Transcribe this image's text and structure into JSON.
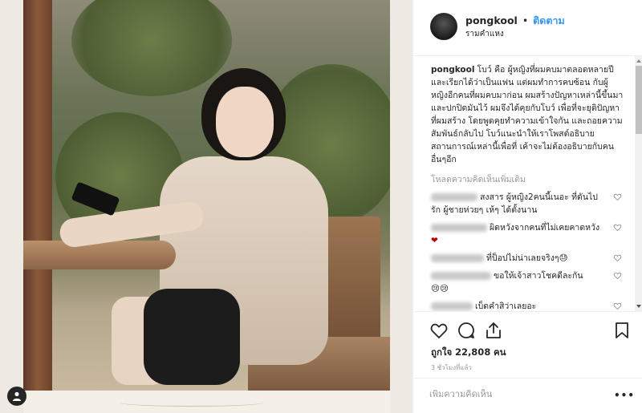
{
  "post": {
    "username": "pongkool",
    "follow_label": "ติดตาม",
    "location": "รามคำแหง",
    "caption_user": "pongkool",
    "caption_text": "โบว์ คือ ผู้หญิงที่ผมคบมาตลอดหลายปี และเรียกได้ว่าเป็นแฟน แต่ผมทำการคบซ้อน กับผู้หญิงอีกคนที่ผมคบมาก่อน ผมสร้างปัญหาเหล่านี้ขึ้นมาและปกปิดมันไว้ ผมจึงได้คุยกับโบว์ เพื่อที่จะยุติปัญหาที่ผมสร้าง โดยพูดคุยทำความเข้าใจกัน และถอยความสัมพันธ์กลับไป โบว์แนะนำให้เราโพสต์อธิบายสถานการณ์เหล่านี้เพื่อที่ เค้าจะไม่ต้องอธิบายกับคนอื่นๆอีก",
    "load_more": "โหลดความคิดเห็นเพิ่มเติม",
    "likes_label": "ถูกใจ",
    "likes_count": "22,808",
    "likes_unit": "คน",
    "time_ago": "3 ชั่วโมงที่แล้ว",
    "comment_placeholder": "เพิ่มความคิดเห็น",
    "more_label": "•••"
  },
  "comments": [
    {
      "text": "สงสาร ผู้หญิง2คนนี้เนอะ ที่ดันไปรัก ผู้ชายห่วยๆ เห้ๆ ได้ตั้งนาน",
      "emoji": ""
    },
    {
      "text": "ผิดหวังจากคนที่ไม่เคยคาดหวัง",
      "emoji": "❤"
    },
    {
      "text": "ที่ป็อปไม่น่าเลยจริงๆ",
      "emoji": "😓"
    },
    {
      "text": "ขอให้เจ้าสาวโชคดีละกัน",
      "emoji": "😢😢"
    },
    {
      "text": "เบ็ดคำสิว่าเลยอะ",
      "emoji": ""
    },
    {
      "text": "",
      "emoji": "👎🏽"
    }
  ],
  "icons": {
    "heart": "heart-icon",
    "comment": "comment-icon",
    "share": "share-icon",
    "save": "bookmark-icon",
    "user_tag": "user-tag-icon"
  },
  "colors": {
    "follow": "#3897f0",
    "text": "#262626",
    "muted": "#999999",
    "emoji_heart": "#c00000"
  }
}
